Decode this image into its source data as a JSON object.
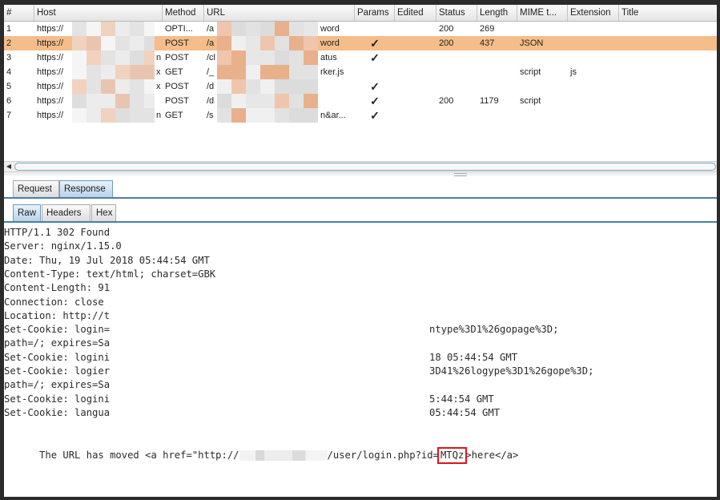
{
  "table": {
    "columns": [
      "#",
      "Host",
      "Method",
      "URL",
      "Params",
      "Edited",
      "Status",
      "Length",
      "MIME t...",
      "Extension",
      "Title"
    ],
    "rows": [
      {
        "num": "1",
        "host": "https://",
        "host_tail": "",
        "method": "OPTI...",
        "url": "/a",
        "url_tail": "word",
        "params": "",
        "status": "200",
        "length": "269",
        "mime": "",
        "ext": ""
      },
      {
        "num": "2",
        "host": "https://",
        "host_tail": "",
        "method": "POST",
        "url": "/a",
        "url_tail": "word",
        "params": "✓",
        "status": "200",
        "length": "437",
        "mime": "JSON",
        "ext": ""
      },
      {
        "num": "3",
        "host": "https://",
        "host_tail": "n",
        "method": "POST",
        "url": "/cl",
        "url_tail": "atus",
        "params": "✓",
        "status": "",
        "length": "",
        "mime": "",
        "ext": ""
      },
      {
        "num": "4",
        "host": "https://",
        "host_tail": "x",
        "method": "GET",
        "url": "/_",
        "url_tail": "rker.js",
        "params": "",
        "status": "",
        "length": "",
        "mime": "script",
        "ext": "js"
      },
      {
        "num": "5",
        "host": "https://",
        "host_tail": "x",
        "method": "POST",
        "url": "/d",
        "url_tail": "",
        "params": "✓",
        "status": "",
        "length": "",
        "mime": "",
        "ext": ""
      },
      {
        "num": "6",
        "host": "https://",
        "host_tail": "",
        "method": "POST",
        "url": "/d",
        "url_tail": "",
        "params": "✓",
        "status": "200",
        "length": "1179",
        "mime": "script",
        "ext": ""
      },
      {
        "num": "7",
        "host": "https://",
        "host_tail": "n",
        "method": "GET",
        "url": "/s",
        "url_tail": "n&ar...",
        "params": "✓",
        "status": "",
        "length": "",
        "mime": "",
        "ext": ""
      }
    ],
    "selected_row": 2
  },
  "outer_tabs": [
    "Request",
    "Response"
  ],
  "outer_active": "Response",
  "inner_tabs": [
    "Raw",
    "Headers",
    "Hex"
  ],
  "inner_active": "Raw",
  "response": {
    "lines": [
      "HTTP/1.1 302 Found",
      "Server: nginx/1.15.0",
      "Date: Thu, 19 Jul 2018 05:44:54 GMT",
      "Content-Type: text/html; charset=GBK",
      "Content-Length: 91",
      "Connection: close",
      "Location: http://t",
      "Set-Cookie: login=",
      "path=/; expires=Sa",
      "Set-Cookie: logini",
      "Set-Cookie: logier",
      "path=/; expires=Sa",
      "Set-Cookie: logini",
      "Set-Cookie: langua"
    ],
    "right_fragments": [
      {
        "line": 7,
        "text": "ntype%3D1%26gopage%3D;"
      },
      {
        "line": 9,
        "text": "18 05:44:54 GMT"
      },
      {
        "line": 10,
        "text": "3D41%26logype%3D1%26gope%3D;"
      },
      {
        "line": 12,
        "text": "5:44:54 GMT"
      },
      {
        "line": 13,
        "text": "05:44:54 GMT"
      }
    ],
    "body_prefix": "The URL has moved <a href=\"http://",
    "body_middle": "/user/login.php?id=",
    "body_highlight": "MTQz",
    "body_suffix": ">here</a>",
    "highlight_color": "#e0141a"
  }
}
